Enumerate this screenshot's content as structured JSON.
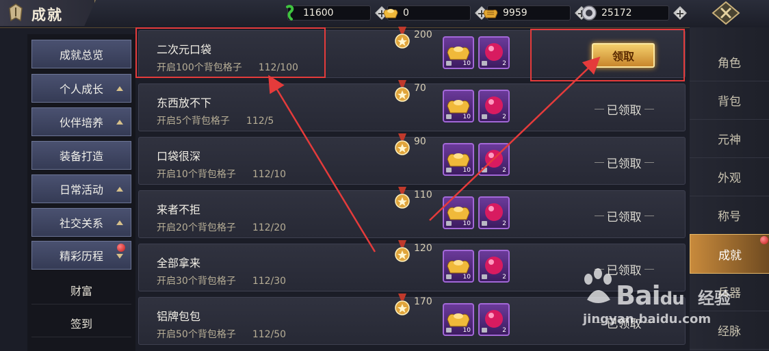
{
  "title": "成就",
  "currencies": [
    {
      "icon": "green-gem-icon",
      "value": "11600",
      "color": "#3fc43f"
    },
    {
      "icon": "gold-ingot-icon",
      "value": "0",
      "color": "#f0b93a"
    },
    {
      "icon": "bound-gold-ingot-icon",
      "value": "9959",
      "color": "#e3a630"
    },
    {
      "icon": "silver-coin-icon",
      "value": "25172",
      "color": "#cfcfd6"
    }
  ],
  "left_nav": [
    {
      "label": "成就总览",
      "arrow": ""
    },
    {
      "label": "个人成长",
      "arrow": "up"
    },
    {
      "label": "伙伴培养",
      "arrow": "up"
    },
    {
      "label": "装备打造",
      "arrow": ""
    },
    {
      "label": "日常活动",
      "arrow": "up"
    },
    {
      "label": "社交关系",
      "arrow": "up"
    },
    {
      "label": "精彩历程",
      "arrow": "down"
    }
  ],
  "left_subnav": [
    "财富",
    "签到"
  ],
  "achievements": [
    {
      "name": "二次元口袋",
      "desc": "开启100个背包格子",
      "progress": "112/100",
      "points": "200",
      "reward_counts": [
        "10",
        "2"
      ],
      "status": "claim"
    },
    {
      "name": "东西放不下",
      "desc": "开启5个背包格子",
      "progress": "112/5",
      "points": "70",
      "reward_counts": [
        "10",
        "2"
      ],
      "status": "claimed"
    },
    {
      "name": "口袋很深",
      "desc": "开启10个背包格子",
      "progress": "112/10",
      "points": "90",
      "reward_counts": [
        "10",
        "2"
      ],
      "status": "claimed"
    },
    {
      "name": "来者不拒",
      "desc": "开启20个背包格子",
      "progress": "112/20",
      "points": "110",
      "reward_counts": [
        "10",
        "2"
      ],
      "status": "claimed"
    },
    {
      "name": "全部拿来",
      "desc": "开启30个背包格子",
      "progress": "112/30",
      "points": "120",
      "reward_counts": [
        "10",
        "2"
      ],
      "status": "claimed"
    },
    {
      "name": "铝牌包包",
      "desc": "开启50个背包格子",
      "progress": "112/50",
      "points": "170",
      "reward_counts": [
        "10",
        "2"
      ],
      "status": "claimed"
    }
  ],
  "claim_label": "领取",
  "claimed_label": "已领取",
  "right_tabs": [
    "角色",
    "背包",
    "元神",
    "外观",
    "称号",
    "成就",
    "兵器",
    "经脉"
  ],
  "active_tab": "成就",
  "watermark": {
    "brand": "Bai",
    "brand_suffix": "du",
    "cn": "经验",
    "url": "jingyan.baidu.com"
  },
  "colors": {
    "highlight": "#e53b3b",
    "gold": "#f4cf6c",
    "purple_slot": "#6b3a9a"
  }
}
